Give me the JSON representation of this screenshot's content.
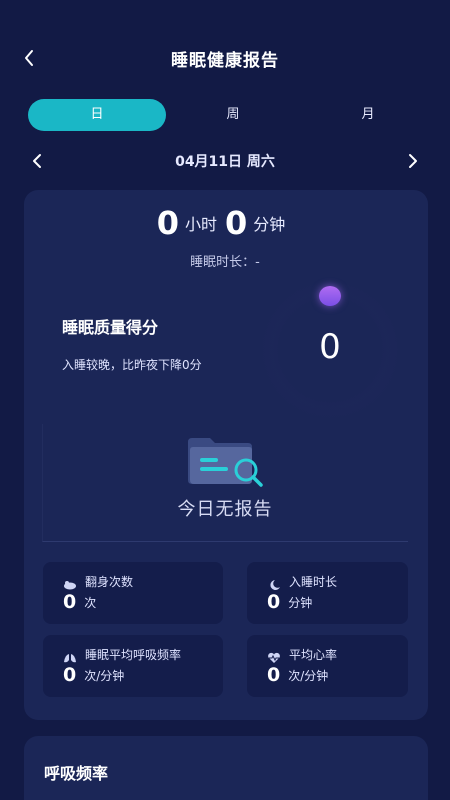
{
  "header": {
    "title": "睡眠健康报告"
  },
  "tabs": [
    {
      "label": "日",
      "active": true
    },
    {
      "label": "周",
      "active": false
    },
    {
      "label": "月",
      "active": false
    }
  ],
  "date": {
    "text": "04月11日 周六"
  },
  "summary": {
    "hours": "0",
    "hours_unit": "小时",
    "minutes": "0",
    "minutes_unit": "分钟",
    "duration_label": "睡眠时长：-"
  },
  "quality": {
    "title": "睡眠质量得分",
    "desc": "入睡较晚，比昨夜下降0分",
    "score": "0"
  },
  "empty": {
    "text": "今日无报告"
  },
  "stats": [
    {
      "icon": "turn-over-icon",
      "label": "翻身次数",
      "value": "0",
      "unit": "次"
    },
    {
      "icon": "moon-icon",
      "label": "入睡时长",
      "value": "0",
      "unit": "分钟"
    },
    {
      "icon": "lungs-icon",
      "label": "睡眠平均呼吸频率",
      "value": "0",
      "unit": "次/分钟"
    },
    {
      "icon": "heart-icon",
      "label": "平均心率",
      "value": "0",
      "unit": "次/分钟"
    }
  ],
  "breathing": {
    "title": "呼吸频率"
  },
  "colors": {
    "background": "#121a45",
    "card": "#1b2657",
    "accent": "#1ab7c6",
    "score_dot": "#9b5ff0"
  }
}
